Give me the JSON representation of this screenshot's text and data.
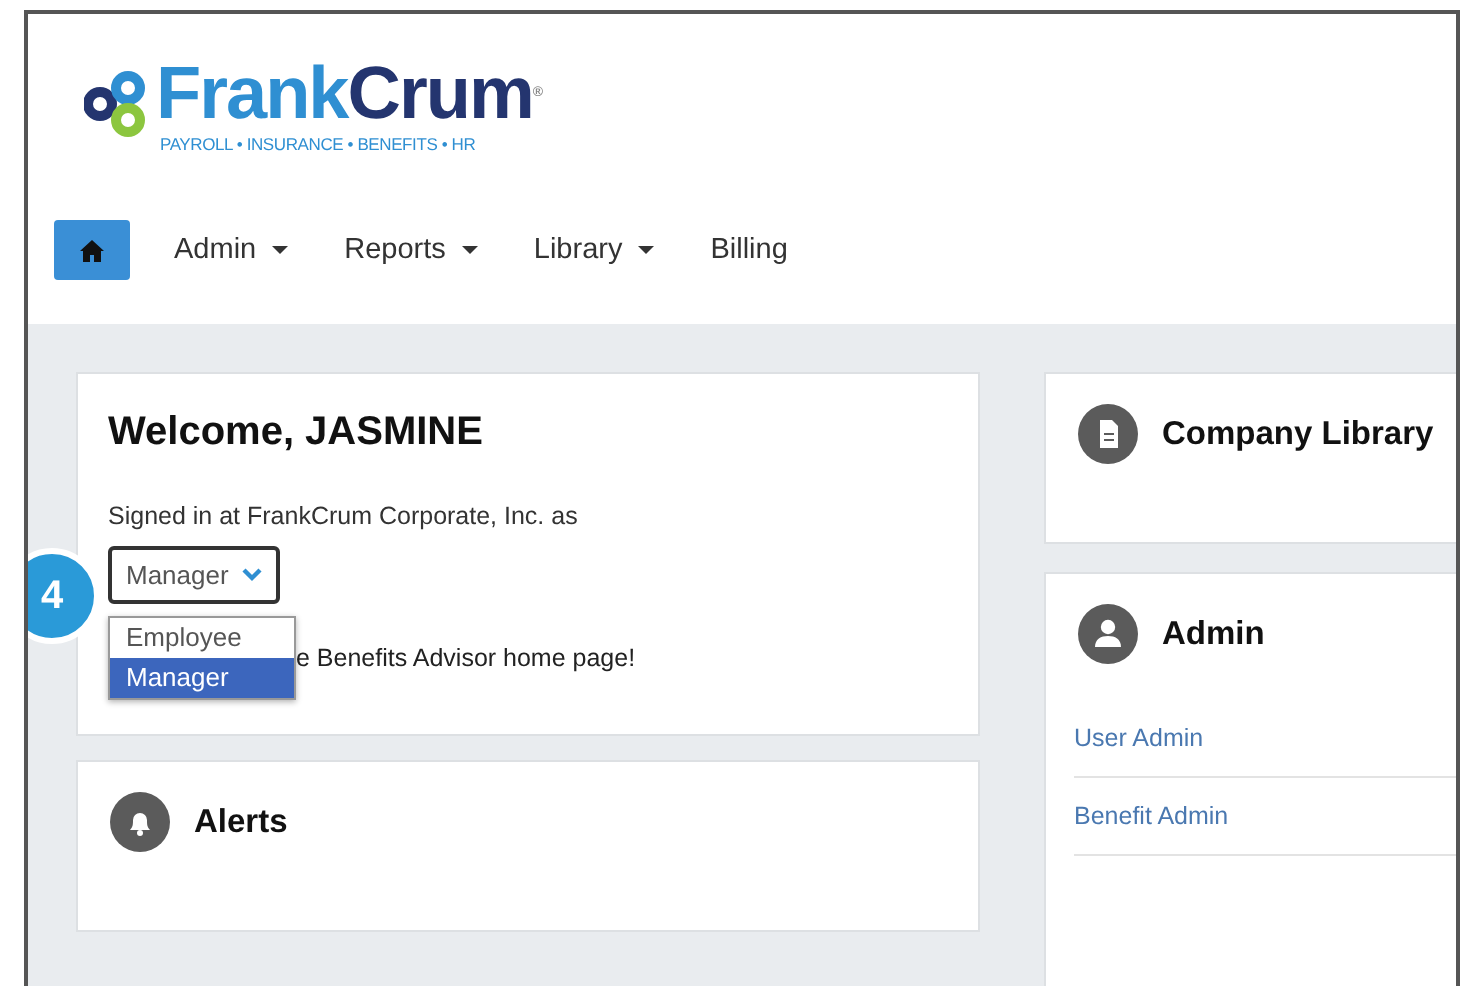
{
  "logo": {
    "wordmark": [
      "Frank",
      "Crum",
      "®"
    ],
    "tagline": "PAYROLL • INSURANCE • BENEFITS • HR"
  },
  "nav": {
    "items": [
      {
        "label": "Admin",
        "dropdown": true
      },
      {
        "label": "Reports",
        "dropdown": true
      },
      {
        "label": "Library",
        "dropdown": true
      },
      {
        "label": "Billing",
        "dropdown": false
      }
    ]
  },
  "callout": {
    "number": "4"
  },
  "welcome": {
    "title": "Welcome, JASMINE",
    "signed_in": "Signed in at FrankCrum Corporate, Inc. as",
    "role_select": {
      "value": "Manager",
      "expanded": true,
      "options": [
        {
          "label": "Employee",
          "selected": false
        },
        {
          "label": "Manager",
          "selected": true
        }
      ]
    },
    "message": "e Benefits Advisor home page!"
  },
  "left_panels": [
    {
      "kind": "alerts",
      "title": "Alerts"
    }
  ],
  "right_panels": [
    {
      "kind": "library",
      "title": "Company Library"
    },
    {
      "kind": "admin",
      "title": "Admin",
      "links": [
        "User Admin",
        "Benefit Admin"
      ]
    }
  ]
}
